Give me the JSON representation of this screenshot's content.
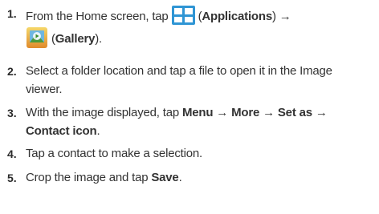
{
  "steps": [
    {
      "number": "1.",
      "t1": "From the Home screen, tap",
      "t2": "(",
      "t3": "Applications",
      "t4": ")",
      "t5": "(",
      "t6": "Gallery",
      "t7": ")."
    },
    {
      "number": "2.",
      "line1": "Select a folder location and tap a file to open it in the Image",
      "line2": "viewer."
    },
    {
      "number": "3.",
      "t1": "With the image displayed, tap",
      "b1": "Menu",
      "b2": "More",
      "b3": "Set as",
      "b4": "Contact icon",
      "t2": "."
    },
    {
      "number": "4.",
      "text": "Tap a contact to make a selection."
    },
    {
      "number": "5.",
      "t1": "Crop the image and tap",
      "b1": "Save",
      "t2": "."
    }
  ],
  "arrow_glyph": "→",
  "icons": {
    "applications": "applications-grid-icon",
    "gallery": "gallery-icon"
  },
  "colors": {
    "text": "#333333",
    "applications_icon": "#2f95d4"
  }
}
